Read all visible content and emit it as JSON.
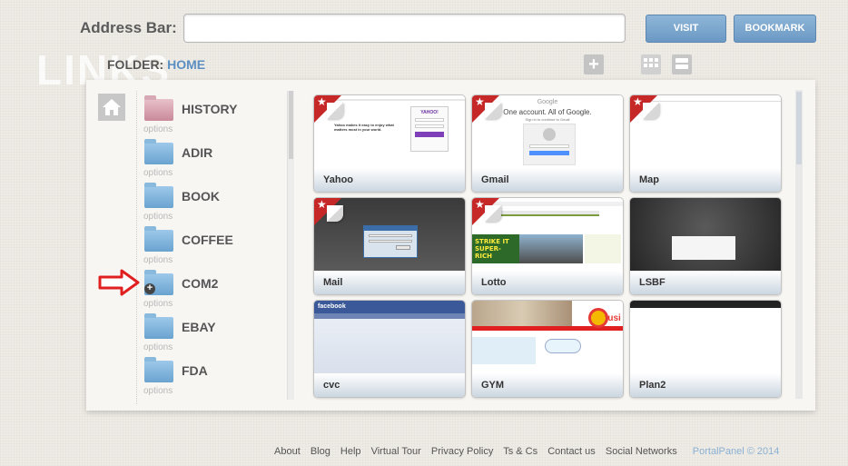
{
  "address_bar": {
    "label": "Address Bar:",
    "value": ""
  },
  "buttons": {
    "visit": "VISIT",
    "bookmark": "BOOKMARK"
  },
  "watermark": "LINKS",
  "folder_path": {
    "label": "FOLDER:",
    "current": "HOME"
  },
  "toolbar": {
    "add_icon": "plus-icon",
    "grid_icon": "grid-view-icon",
    "list_icon": "list-view-icon",
    "add_glyph": "+"
  },
  "sidebar": {
    "options_label": "options",
    "folders": [
      {
        "name": "HISTORY",
        "color": "#c9899a"
      },
      {
        "name": "ADIR"
      },
      {
        "name": "BOOK"
      },
      {
        "name": "COFFEE"
      },
      {
        "name": "COM2"
      },
      {
        "name": "EBAY"
      },
      {
        "name": "FDA"
      }
    ]
  },
  "tiles": [
    {
      "label": "Yahoo"
    },
    {
      "label": "Gmail"
    },
    {
      "label": "Map"
    },
    {
      "label": "Mail"
    },
    {
      "label": "Lotto"
    },
    {
      "label": "LSBF"
    },
    {
      "label": "cvc"
    },
    {
      "label": "GYM"
    },
    {
      "label": "Plan2"
    }
  ],
  "thumbnails": {
    "yahoo_logo": "YAHOO!",
    "yahoo_tagline": "Yahoo makes it easy to enjoy what matters most in your world.",
    "google_logo": "Google",
    "gmail_heading": "One account. All of Google.",
    "gmail_sub": "Sign in to continue to Gmail",
    "lotto_banner": "STRIKE IT SUPER-RICH",
    "facebook_logo": "facebook",
    "gym_logo": "fusi"
  },
  "footer": {
    "links": [
      "About",
      "Blog",
      "Help",
      "Virtual Tour",
      "Privacy Policy",
      "Ts & Cs",
      "Contact us",
      "Social Networks"
    ],
    "brand": "PortalPanel © 2014"
  },
  "colors": {
    "accent": "#6b99c4",
    "brand": "#8ab0d4",
    "flag": "#c62828",
    "annotation_arrow": "#e02020"
  }
}
